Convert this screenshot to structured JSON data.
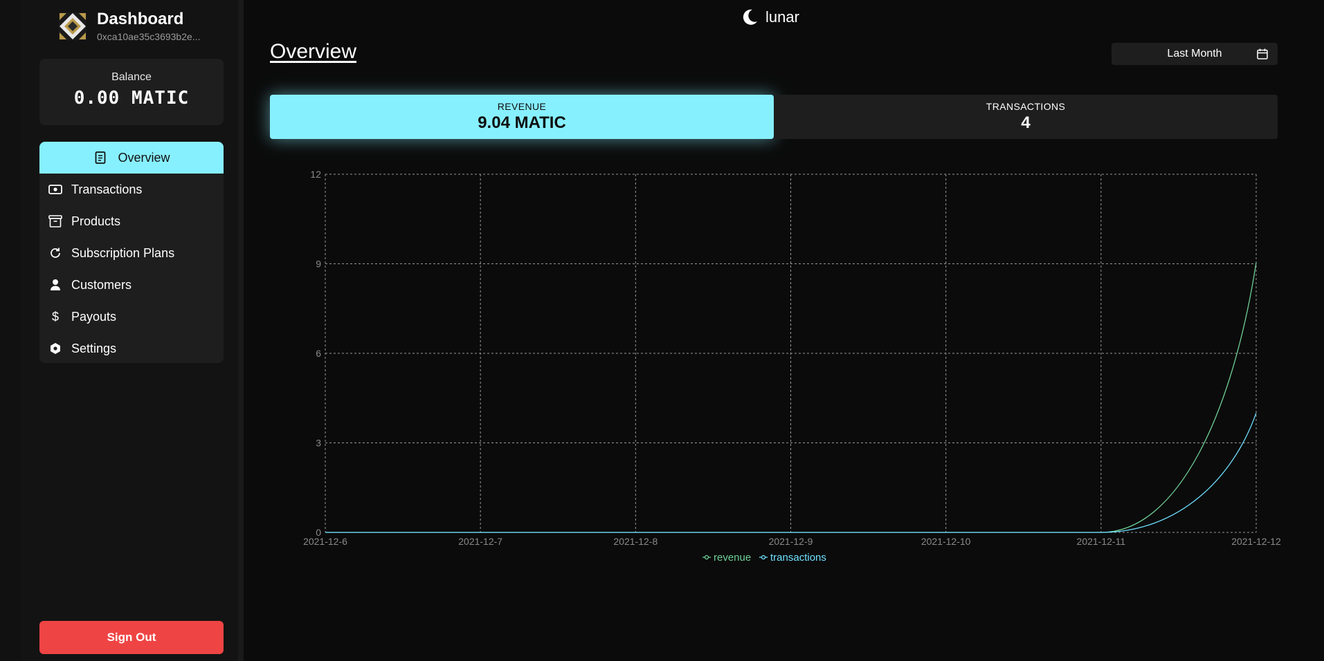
{
  "app": {
    "title": "Dashboard",
    "account": "0xca10ae35c3693b2e..."
  },
  "balance": {
    "label": "Balance",
    "value": "0.00 MATIC"
  },
  "sidebar": {
    "items": [
      {
        "label": "Overview",
        "icon": "document-icon",
        "active": true
      },
      {
        "label": "Transactions",
        "icon": "cash-icon",
        "active": false
      },
      {
        "label": "Products",
        "icon": "archive-box-icon",
        "active": false
      },
      {
        "label": "Subscription Plans",
        "icon": "refresh-icon",
        "active": false
      },
      {
        "label": "Customers",
        "icon": "user-icon",
        "active": false
      },
      {
        "label": "Payouts",
        "icon": "dollar-icon",
        "active": false
      },
      {
        "label": "Settings",
        "icon": "cog-icon",
        "active": false
      }
    ],
    "sign_out": "Sign Out"
  },
  "topbar": {
    "theme_label": "lunar",
    "theme_icon": "moon-icon"
  },
  "main": {
    "title": "Overview",
    "range": "Last Month"
  },
  "stats": [
    {
      "label": "REVENUE",
      "value": "9.04 MATIC",
      "active": true
    },
    {
      "label": "TRANSACTIONS",
      "value": "4",
      "active": false
    }
  ],
  "colors": {
    "accent": "#87f0ff",
    "danger": "#ef4444",
    "revenue_line": "#6fcf97",
    "transactions_line": "#6fe0ff"
  },
  "chart_data": {
    "type": "line",
    "x": [
      "2021-12-6",
      "2021-12-7",
      "2021-12-8",
      "2021-12-9",
      "2021-12-10",
      "2021-12-11",
      "2021-12-12"
    ],
    "series": [
      {
        "name": "revenue",
        "values": [
          0,
          0,
          0,
          0,
          0,
          0,
          9.04
        ]
      },
      {
        "name": "transactions",
        "values": [
          0,
          0,
          0,
          0,
          0,
          0,
          4
        ]
      }
    ],
    "yticks": [
      0,
      3,
      6,
      9,
      12
    ],
    "ylim": [
      0,
      12
    ],
    "grid": true,
    "legend": "bottom-center"
  }
}
